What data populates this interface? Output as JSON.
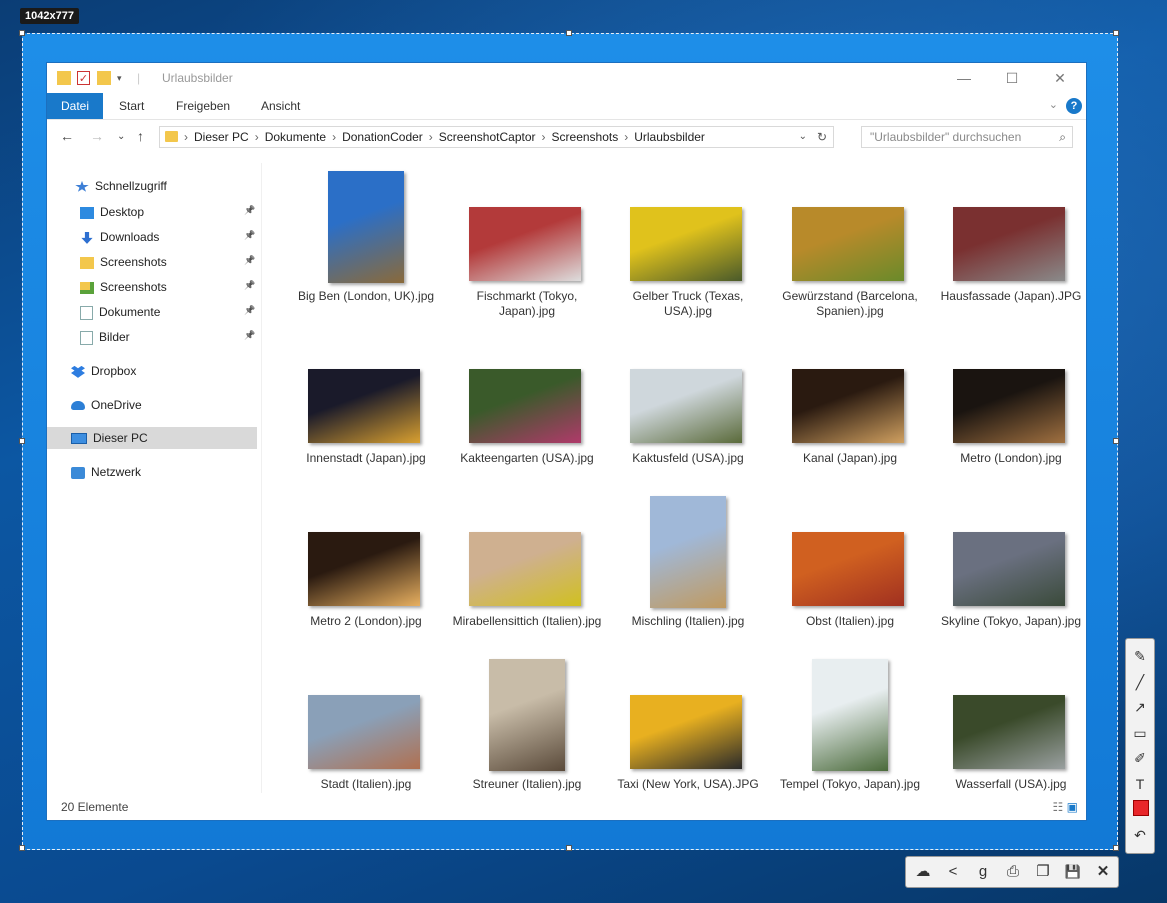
{
  "capture": {
    "dimension_label": "1042x777"
  },
  "window": {
    "title": "Urlaubsbilder",
    "ribbon_tabs": [
      "Datei",
      "Start",
      "Freigeben",
      "Ansicht"
    ],
    "help": "?",
    "address": {
      "crumbs": [
        "Dieser PC",
        "Dokumente",
        "DonationCoder",
        "ScreenshotCaptor",
        "Screenshots",
        "Urlaubsbilder"
      ],
      "separator": "›"
    },
    "search_placeholder": "\"Urlaubsbilder\" durchsuchen",
    "sidebar": [
      {
        "label": "Schnellzugriff",
        "icon": "star-icon",
        "pinned": false
      },
      {
        "label": "Desktop",
        "icon": "desktop-folder-icon",
        "pinned": true
      },
      {
        "label": "Downloads",
        "icon": "download-arrow-icon",
        "pinned": true
      },
      {
        "label": "Screenshots",
        "icon": "folder-icon",
        "pinned": true
      },
      {
        "label": "Screenshots",
        "icon": "folder-green-icon",
        "pinned": true
      },
      {
        "label": "Dokumente",
        "icon": "document-icon",
        "pinned": true
      },
      {
        "label": "Bilder",
        "icon": "pictures-icon",
        "pinned": true
      },
      {
        "label": "Dropbox",
        "icon": "dropbox-icon",
        "pinned": false
      },
      {
        "label": "OneDrive",
        "icon": "cloud-icon",
        "pinned": false
      },
      {
        "label": "Dieser PC",
        "icon": "computer-icon",
        "pinned": false,
        "selected": true
      },
      {
        "label": "Netzwerk",
        "icon": "network-icon",
        "pinned": false
      }
    ],
    "files": [
      {
        "name": "Big Ben (London, UK).jpg",
        "colors": [
          "#2b6fc7",
          "#8a6a3a"
        ]
      },
      {
        "name": "Fischmarkt (Tokyo, Japan).jpg",
        "colors": [
          "#b33a3a",
          "#ddd"
        ]
      },
      {
        "name": "Gelber Truck (Texas, USA).jpg",
        "colors": [
          "#e0c21c",
          "#4a5a2a"
        ]
      },
      {
        "name": "Gewürzstand (Barcelona, Spanien).jpg",
        "colors": [
          "#b88a2a",
          "#6a8a2a"
        ]
      },
      {
        "name": "Hausfassade (Japan).JPG",
        "colors": [
          "#7a3030",
          "#8a8a8a"
        ]
      },
      {
        "name": "Innenstadt (Japan).jpg",
        "colors": [
          "#1a1a2a",
          "#d9a030"
        ]
      },
      {
        "name": "Kakteengarten (USA).jpg",
        "colors": [
          "#3a5a2a",
          "#b03a6a"
        ]
      },
      {
        "name": "Kaktusfeld (USA).jpg",
        "colors": [
          "#cfd7dc",
          "#5a6a3a"
        ]
      },
      {
        "name": "Kanal (Japan).jpg",
        "colors": [
          "#2a1a10",
          "#d0a060"
        ]
      },
      {
        "name": "Metro (London).jpg",
        "colors": [
          "#1a1410",
          "#a07040"
        ]
      },
      {
        "name": "Metro 2 (London).jpg",
        "colors": [
          "#2a1a10",
          "#e8b060"
        ]
      },
      {
        "name": "Mirabellensittich (Italien).jpg",
        "colors": [
          "#cfb090",
          "#d0c020"
        ]
      },
      {
        "name": "Mischling (Italien).jpg",
        "colors": [
          "#a0b8d8",
          "#c09a60"
        ]
      },
      {
        "name": "Obst (Italien).jpg",
        "colors": [
          "#d06020",
          "#a03020"
        ]
      },
      {
        "name": "Skyline (Tokyo, Japan).jpg",
        "colors": [
          "#6a7080",
          "#3a4a3a"
        ]
      },
      {
        "name": "Stadt (Italien).jpg",
        "colors": [
          "#8aa0b8",
          "#b07050"
        ]
      },
      {
        "name": "Streuner (Italien).jpg",
        "colors": [
          "#c8bca8",
          "#5a4a3a"
        ]
      },
      {
        "name": "Taxi (New York, USA).JPG",
        "colors": [
          "#e8b020",
          "#2a2a2a"
        ]
      },
      {
        "name": "Tempel (Tokyo, Japan).jpg",
        "colors": [
          "#e8eef0",
          "#4a6a3a"
        ]
      },
      {
        "name": "Wasserfall (USA).jpg",
        "colors": [
          "#3a4a2a",
          "#9aa0a0"
        ]
      }
    ],
    "status": "20 Elemente"
  },
  "annotation_tools": [
    "pencil-icon",
    "line-icon",
    "arrow-icon",
    "rectangle-icon",
    "highlighter-icon",
    "text-icon",
    "color-swatch-icon",
    "undo-icon"
  ],
  "action_tools": [
    "upload-cloud-icon",
    "share-icon",
    "google-plus-icon",
    "print-icon",
    "copy-icon",
    "save-icon",
    "close-icon"
  ],
  "accent_color": "#1979ca",
  "swatch_color": "#e8262a"
}
